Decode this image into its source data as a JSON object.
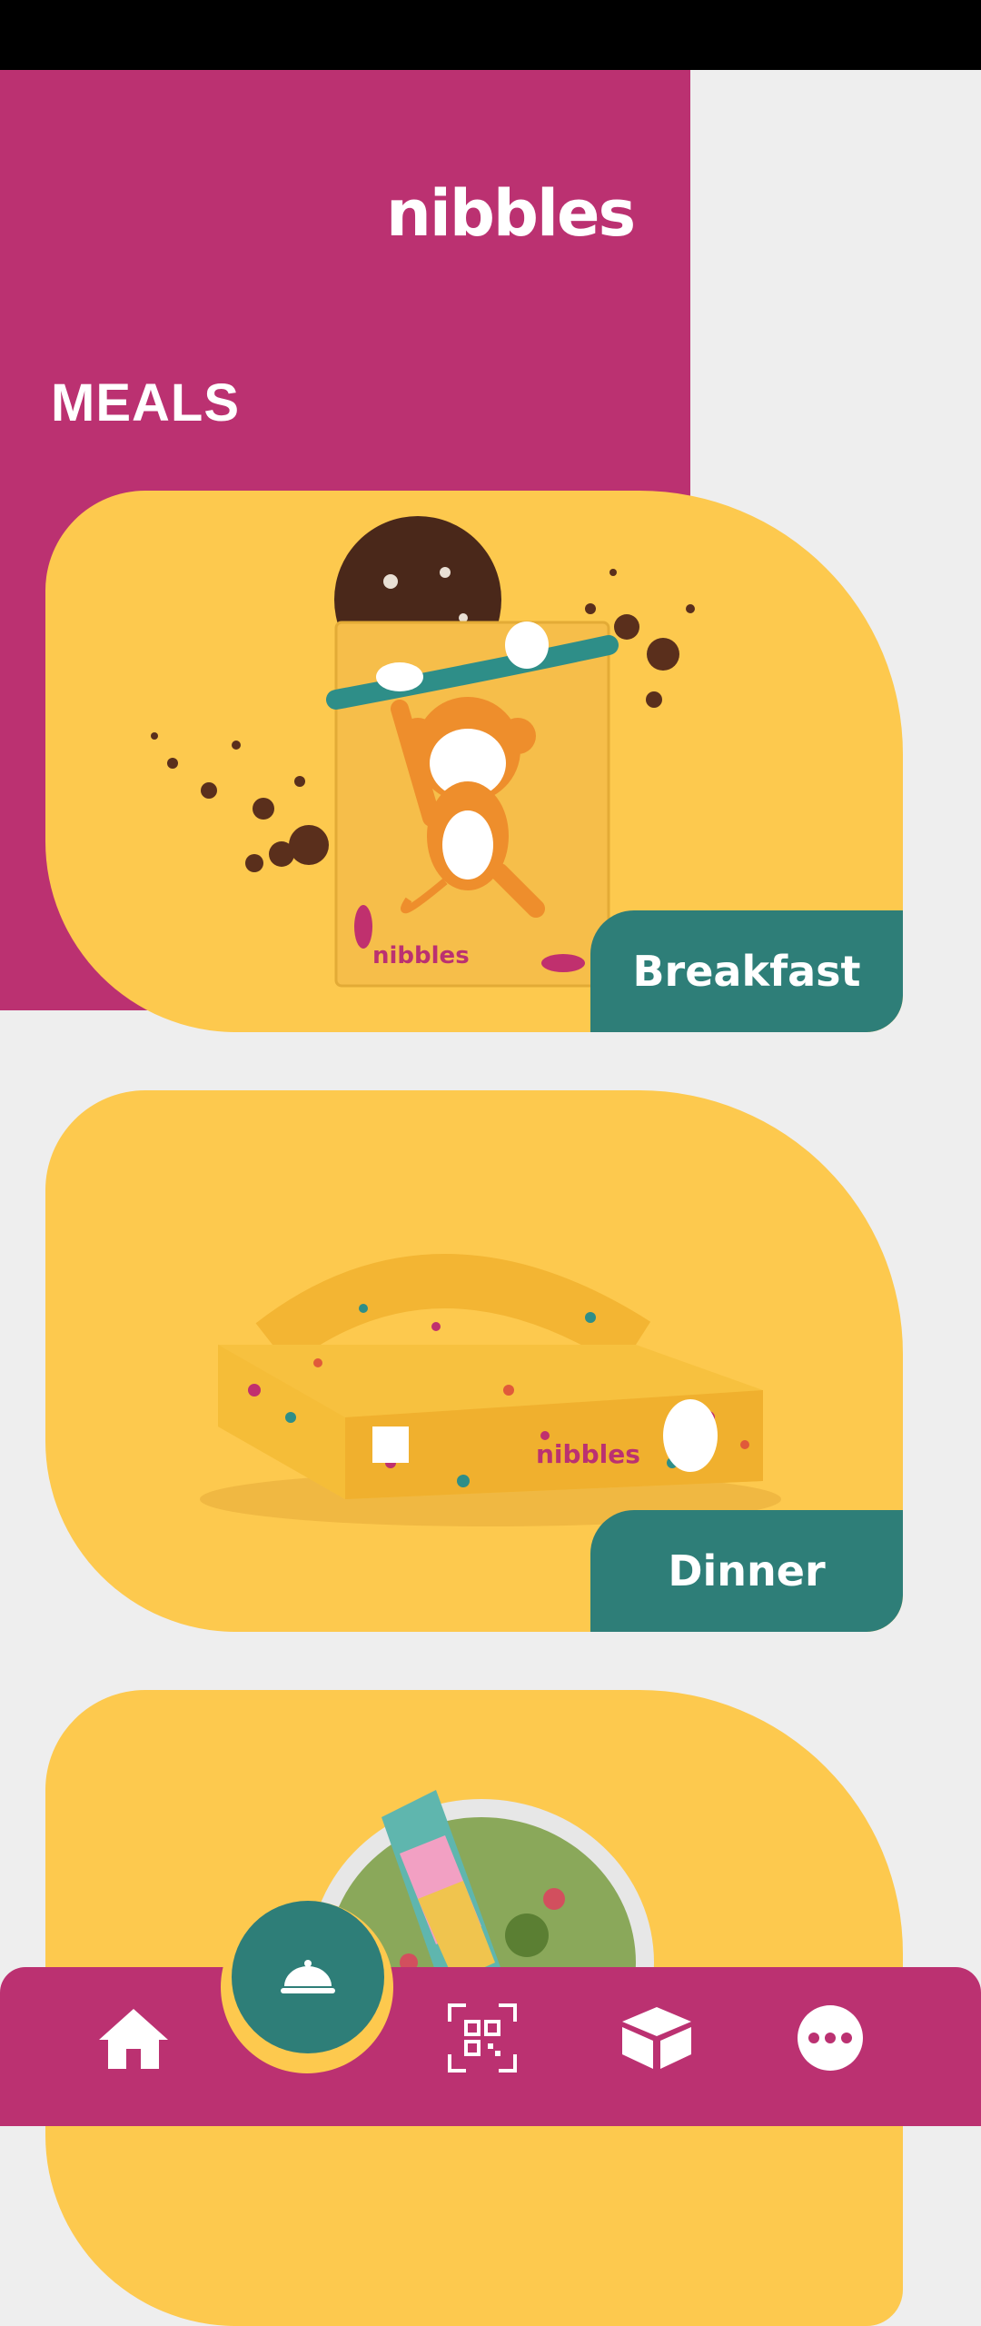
{
  "app": {
    "brand": "nibbles"
  },
  "page": {
    "title": "MEALS"
  },
  "cards": [
    {
      "label": "Breakfast",
      "brand_print": "nibbles"
    },
    {
      "label": "Dinner",
      "brand_print": "nibbles"
    },
    {
      "label": ""
    }
  ],
  "nav": {
    "items": [
      {
        "icon": "home-icon"
      },
      {
        "icon": "meal-cloche-icon",
        "active": true
      },
      {
        "icon": "qr-scan-icon"
      },
      {
        "icon": "box-icon"
      },
      {
        "icon": "more-icon"
      }
    ]
  },
  "colors": {
    "brand": "#bb3171",
    "accent": "#2e7e78",
    "card": "#fdc94e",
    "background": "#eeeeee"
  }
}
